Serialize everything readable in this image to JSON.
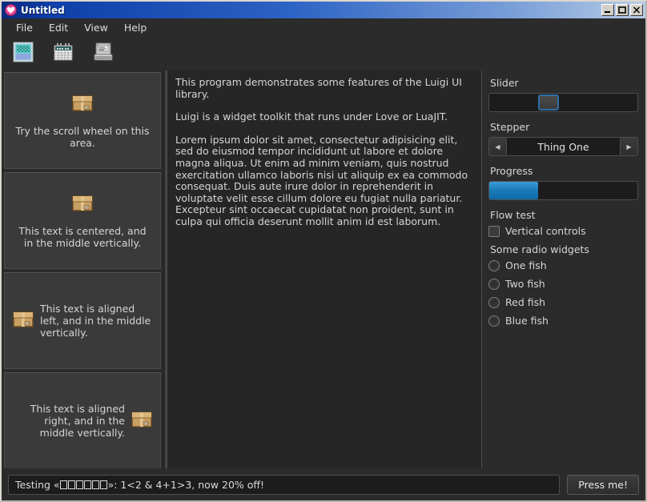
{
  "window": {
    "title": "Untitled",
    "icon": "heart-app-icon",
    "buttons": [
      {
        "name": "minimize-button",
        "glyph": "_"
      },
      {
        "name": "maximize-button",
        "glyph": "□"
      },
      {
        "name": "close-button",
        "glyph": "✕"
      }
    ]
  },
  "menubar": {
    "items": [
      {
        "label": "File"
      },
      {
        "label": "Edit"
      },
      {
        "label": "View"
      },
      {
        "label": "Help"
      }
    ]
  },
  "toolbar": {
    "buttons": [
      {
        "name": "image-icon",
        "title": "Image"
      },
      {
        "name": "calendar-icon",
        "title": "Calendar"
      },
      {
        "name": "printer-icon",
        "title": "Printer"
      }
    ]
  },
  "left_panel": {
    "cells": [
      {
        "align": "center-vert",
        "text": "Try the scroll wheel on this area.",
        "icon": "package-box-icon"
      },
      {
        "align": "center-vert",
        "text": "This text is centered, and in the middle vertically.",
        "icon": "package-box-icon"
      },
      {
        "align": "left-middle",
        "text": "This text is aligned left, and in the middle vertically.",
        "icon": "package-box-icon"
      },
      {
        "align": "right-middle",
        "text": "This text is aligned right, and in the middle vertically.",
        "icon": "package-box-icon"
      }
    ]
  },
  "center_panel": {
    "paragraphs": [
      "This program demonstrates some features of the Luigi UI library.",
      "Luigi is a widget toolkit that runs under Love or LuaJIT.",
      "Lorem ipsum dolor sit amet, consectetur adipisicing elit, sed do eiusmod tempor incididunt ut labore et dolore magna aliqua. Ut enim ad minim veniam, quis nostrud exercitation ullamco laboris nisi ut aliquip ex ea commodo consequat. Duis aute irure dolor in reprehenderit in voluptate velit esse cillum dolore eu fugiat nulla pariatur. Excepteur sint occaecat cupidatat non proident, sunt in culpa qui officia deserunt mollit anim id est laborum."
    ]
  },
  "right_panel": {
    "slider": {
      "label": "Slider",
      "value_percent": 33
    },
    "stepper": {
      "label": "Stepper",
      "value": "Thing One",
      "prev_glyph": "◀",
      "next_glyph": "▶"
    },
    "progress": {
      "label": "Progress",
      "value_percent": 33
    },
    "flow_test": {
      "label": "Flow test",
      "checkbox": {
        "label": "Vertical controls",
        "checked": false
      }
    },
    "radios": {
      "label": "Some radio widgets",
      "options": [
        {
          "label": "One fish",
          "selected": false
        },
        {
          "label": "Two fish",
          "selected": false
        },
        {
          "label": "Red fish",
          "selected": false
        },
        {
          "label": "Blue fish",
          "selected": false
        }
      ]
    }
  },
  "statusbar": {
    "text_before": "Testing «",
    "tofu_count": 6,
    "text_after": "»: 1<2 & 4+1>3, now 20% off!",
    "button_label": "Press me!"
  },
  "colors": {
    "accent_blue": "#1a7ab8",
    "panel_bg": "#2b2b2b",
    "cell_bg": "#3a3a3a",
    "text": "#d5d5d5",
    "titlebar_start": "#0a2a80",
    "titlebar_end": "#b8cbe6"
  }
}
